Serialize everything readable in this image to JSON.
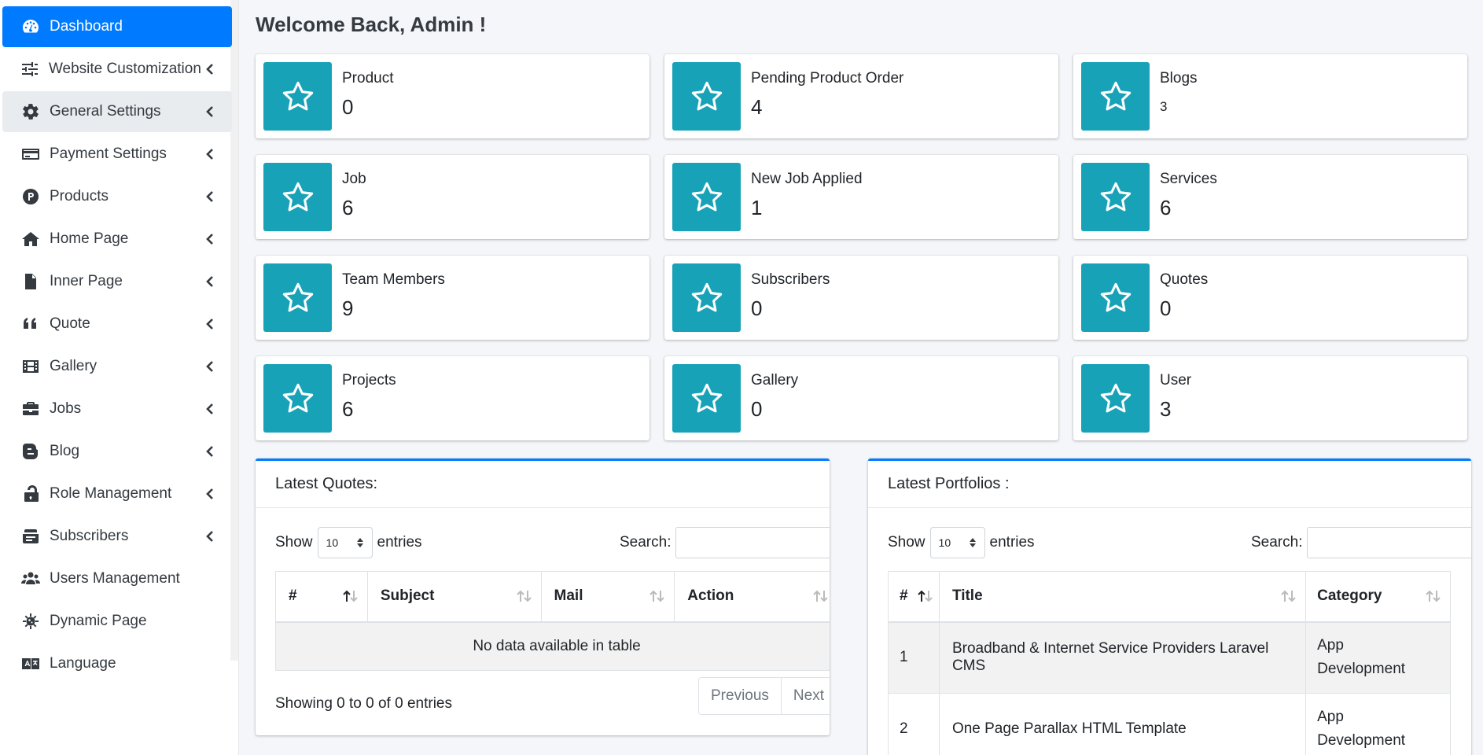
{
  "colors": {
    "primary": "#007bff",
    "info": "#17a2b8",
    "sidebar_hover": "#e9ecef"
  },
  "sidebar": {
    "items": [
      {
        "label": "Dashboard",
        "icon": "tachometer-icon",
        "active": true,
        "chevron": false
      },
      {
        "label": "Website Customization",
        "icon": "sliders-icon",
        "chevron": true
      },
      {
        "label": "General Settings",
        "icon": "gear-icon",
        "chevron": true,
        "hover": true
      },
      {
        "label": "Payment Settings",
        "icon": "credit-card-icon",
        "chevron": true
      },
      {
        "label": "Products",
        "icon": "product-p-icon",
        "chevron": true
      },
      {
        "label": "Home Page",
        "icon": "home-icon",
        "chevron": true
      },
      {
        "label": "Inner Page",
        "icon": "file-icon",
        "chevron": true
      },
      {
        "label": "Quote",
        "icon": "quote-left-icon",
        "chevron": true
      },
      {
        "label": "Gallery",
        "icon": "film-icon",
        "chevron": true
      },
      {
        "label": "Jobs",
        "icon": "briefcase-icon",
        "chevron": true
      },
      {
        "label": "Blog",
        "icon": "blogger-icon",
        "chevron": true
      },
      {
        "label": "Role Management",
        "icon": "unlock-icon",
        "chevron": true
      },
      {
        "label": "Subscribers",
        "icon": "mail-bulk-icon",
        "chevron": true
      },
      {
        "label": "Users Management",
        "icon": "users-icon",
        "chevron": false
      },
      {
        "label": "Dynamic Page",
        "icon": "virus-icon",
        "chevron": false
      },
      {
        "label": "Language",
        "icon": "language-icon",
        "chevron": false
      }
    ]
  },
  "main": {
    "welcome": "Welcome Back, Admin !",
    "cards": [
      {
        "label": "Product",
        "value": "0",
        "icon": "star-icon"
      },
      {
        "label": "Pending Product Order",
        "value": "4",
        "icon": "star-icon"
      },
      {
        "label": "Blogs",
        "value": "3",
        "icon": "star-icon"
      },
      {
        "label": "Job",
        "value": "6",
        "icon": "star-icon"
      },
      {
        "label": "New Job Applied",
        "value": "1",
        "icon": "star-icon"
      },
      {
        "label": "Services",
        "value": "6",
        "icon": "star-icon"
      },
      {
        "label": "Team Members",
        "value": "9",
        "icon": "star-icon"
      },
      {
        "label": "Subscribers",
        "value": "0",
        "icon": "star-icon"
      },
      {
        "label": "Quotes",
        "value": "0",
        "icon": "star-icon"
      },
      {
        "label": "Projects",
        "value": "6",
        "icon": "star-icon"
      },
      {
        "label": "Gallery",
        "value": "0",
        "icon": "star-icon"
      },
      {
        "label": "User",
        "value": "3",
        "icon": "star-icon"
      }
    ],
    "quotes_panel": {
      "title": "Latest Quotes:",
      "show_label": "Show",
      "entries_label": "entries",
      "page_size": "10",
      "search_label": "Search:",
      "columns": [
        "#",
        "Subject",
        "Mail",
        "Action"
      ],
      "empty_text": "No data available in table",
      "info": "Showing 0 to 0 of 0 entries",
      "prev": "Previous",
      "next": "Next"
    },
    "portfolios_panel": {
      "title": "Latest Portfolios :",
      "show_label": "Show",
      "entries_label": "entries",
      "page_size": "10",
      "search_label": "Search:",
      "columns": [
        "#",
        "Title",
        "Category"
      ],
      "rows": [
        {
          "num": "1",
          "title": "Broadband & Internet Service Providers Laravel CMS",
          "category_line1": "App",
          "category_line2": "Development"
        },
        {
          "num": "2",
          "title": "One Page Parallax HTML Template",
          "category_line1": "App",
          "category_line2": "Development"
        }
      ]
    }
  }
}
